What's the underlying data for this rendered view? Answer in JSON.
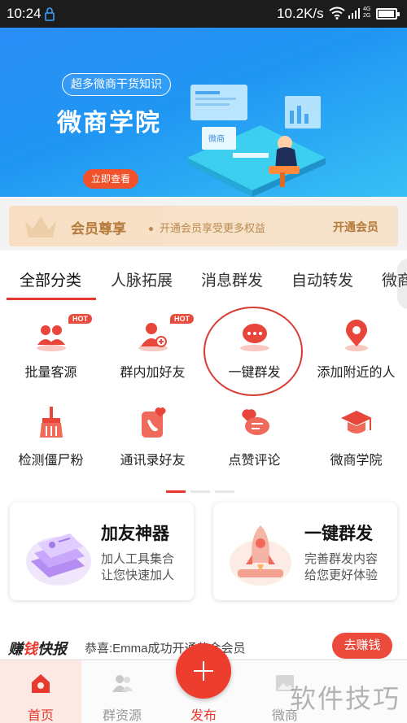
{
  "status_bar": {
    "time": "10:24",
    "speed": "10.2K/s",
    "network_top": "4G",
    "network_bottom": "2G"
  },
  "banner": {
    "tag": "超多微商干货知识",
    "title": "微商学院",
    "cta": "立即查看",
    "screen_text": "微商",
    "slides_total": 3,
    "active_slide": 3
  },
  "member": {
    "name": "会员尊享",
    "desc": "开通会员享受更多权益",
    "open": "开通会员"
  },
  "tabs": [
    "全部分类",
    "人脉拓展",
    "消息群发",
    "自动转发",
    "微商"
  ],
  "active_tab": 0,
  "grid": [
    {
      "label": "批量客源",
      "icon": "users-icon",
      "hot": "HOT"
    },
    {
      "label": "群内加好友",
      "icon": "add-user-icon",
      "hot": "HOT"
    },
    {
      "label": "一键群发",
      "icon": "chat-bubble-icon",
      "hot": ""
    },
    {
      "label": "添加附近的人",
      "icon": "location-pin-icon",
      "hot": ""
    },
    {
      "label": "检测僵尸粉",
      "icon": "broom-icon",
      "hot": ""
    },
    {
      "label": "通讯录好友",
      "icon": "phone-book-icon",
      "hot": ""
    },
    {
      "label": "点赞评论",
      "icon": "like-comment-icon",
      "hot": ""
    },
    {
      "label": "微商学院",
      "icon": "graduation-cap-icon",
      "hot": ""
    }
  ],
  "cards": [
    {
      "title": "加友神器",
      "line1": "加人工具集合",
      "line2": "让您快速加人",
      "icon": "id-cards-icon"
    },
    {
      "title": "一键群发",
      "line1": "完善群发内容",
      "line2": "给您更好体验",
      "icon": "rocket-icon"
    }
  ],
  "news": {
    "brand_1": "赚",
    "brand_2": "钱",
    "brand_3": "快报",
    "text": "恭喜:Emma成功开通黄金会员",
    "earn": "去赚钱"
  },
  "nav": {
    "home": "首页",
    "groups": "群资源",
    "publish": "发布",
    "weishang": "微商"
  },
  "watermark": "软件技巧",
  "colors": {
    "accent": "#e8392e",
    "banner": "#2096f3",
    "gold": "#b5793a"
  }
}
